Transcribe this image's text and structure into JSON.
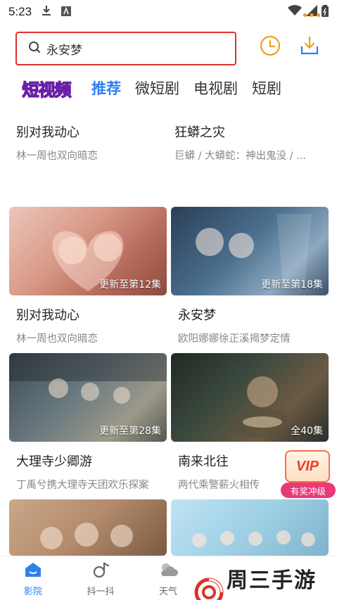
{
  "status_bar": {
    "time": "5:23"
  },
  "search": {
    "query": "永安梦"
  },
  "tabs": {
    "logo": "短视频",
    "items": [
      "推荐",
      "微短剧",
      "电视剧",
      "短剧"
    ]
  },
  "top_row": [
    {
      "title": "别对我动心",
      "subtitle": "林一周也双向暗恋"
    },
    {
      "title": "狂蟒之灾",
      "subtitle": "巨蟒 / 大蟒蛇：神出鬼没 / ..."
    }
  ],
  "cards": [
    {
      "title": "别对我动心",
      "subtitle": "林一周也双向暗恋",
      "badge": "更新至第12集"
    },
    {
      "title": "永安梦",
      "subtitle": "欧阳娜娜徐正溪揭梦定情",
      "badge": "更新至第18集"
    },
    {
      "title": "大理寺少卿游",
      "subtitle": "丁禹兮携大理寺天团欢乐探案",
      "badge": "更新至第28集"
    },
    {
      "title": "南来北往",
      "subtitle": "两代乘警薪火相传",
      "badge": "全40集"
    }
  ],
  "vip_promo": {
    "badge": "VIP",
    "label": "有奖冲级"
  },
  "bottom_nav": {
    "items": [
      "影院",
      "抖一抖",
      "天气"
    ]
  },
  "watermark": {
    "text": "周三手游网"
  },
  "colors": {
    "accent": "#2f7ff0",
    "search_border": "#e03030",
    "vip": "#e83a78"
  },
  "icons": [
    "search-icon",
    "clock-icon",
    "download-icon",
    "more-icon",
    "home-icon",
    "douyin-icon",
    "weather-icon"
  ]
}
